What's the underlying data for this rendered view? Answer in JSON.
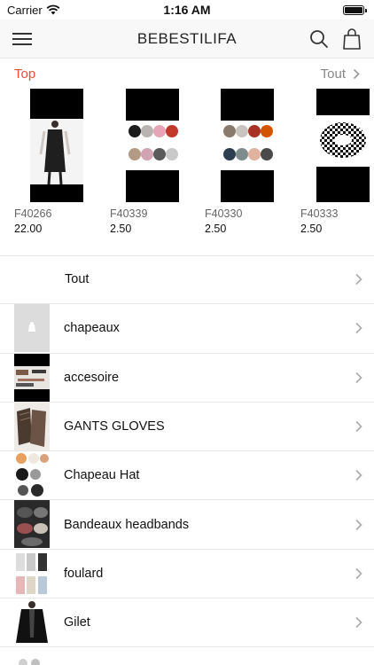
{
  "status_bar": {
    "carrier": "Carrier",
    "time": "1:16 AM"
  },
  "nav": {
    "title": "BEBESTILIFA"
  },
  "top_section": {
    "label": "Top",
    "see_all": "Tout"
  },
  "products": [
    {
      "code": "F40266",
      "price": "22.00"
    },
    {
      "code": "F40339",
      "price": "2.50"
    },
    {
      "code": "F40330",
      "price": "2.50"
    },
    {
      "code": "F40333",
      "price": "2.50"
    }
  ],
  "categories": [
    {
      "label": "Tout"
    },
    {
      "label": "chapeaux"
    },
    {
      "label": "accesoire"
    },
    {
      "label": "GANTS GLOVES"
    },
    {
      "label": "Chapeau Hat"
    },
    {
      "label": "Bandeaux headbands"
    },
    {
      "label": "foulard"
    },
    {
      "label": "Gilet"
    }
  ],
  "colors": {
    "accent": "#e84b3c",
    "muted": "#888888",
    "divider": "#e6e6e6"
  }
}
